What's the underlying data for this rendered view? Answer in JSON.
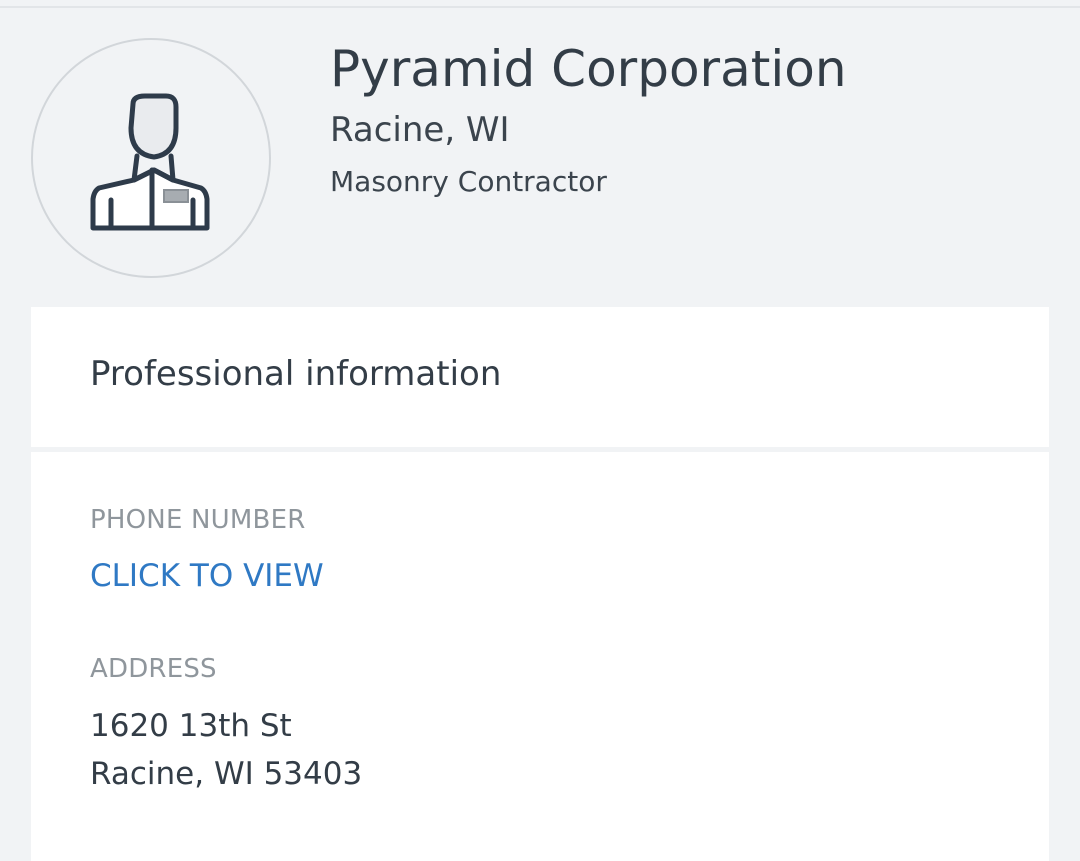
{
  "profile": {
    "avatar_icon": "professional-person-icon",
    "company_name": "Pyramid Corporation",
    "location": "Racine, WI",
    "trade": "Masonry Contractor"
  },
  "professional_info": {
    "section_title": "Professional information",
    "phone": {
      "label": "PHONE NUMBER",
      "action_text": "CLICK TO VIEW"
    },
    "address": {
      "label": "ADDRESS",
      "line1": "1620 13th St",
      "line2": "Racine, WI 53403"
    }
  },
  "colors": {
    "page_background": "#f1f3f5",
    "card_background": "#ffffff",
    "primary_text": "#333d47",
    "secondary_label": "#8f969c",
    "link": "#2f79c4"
  }
}
